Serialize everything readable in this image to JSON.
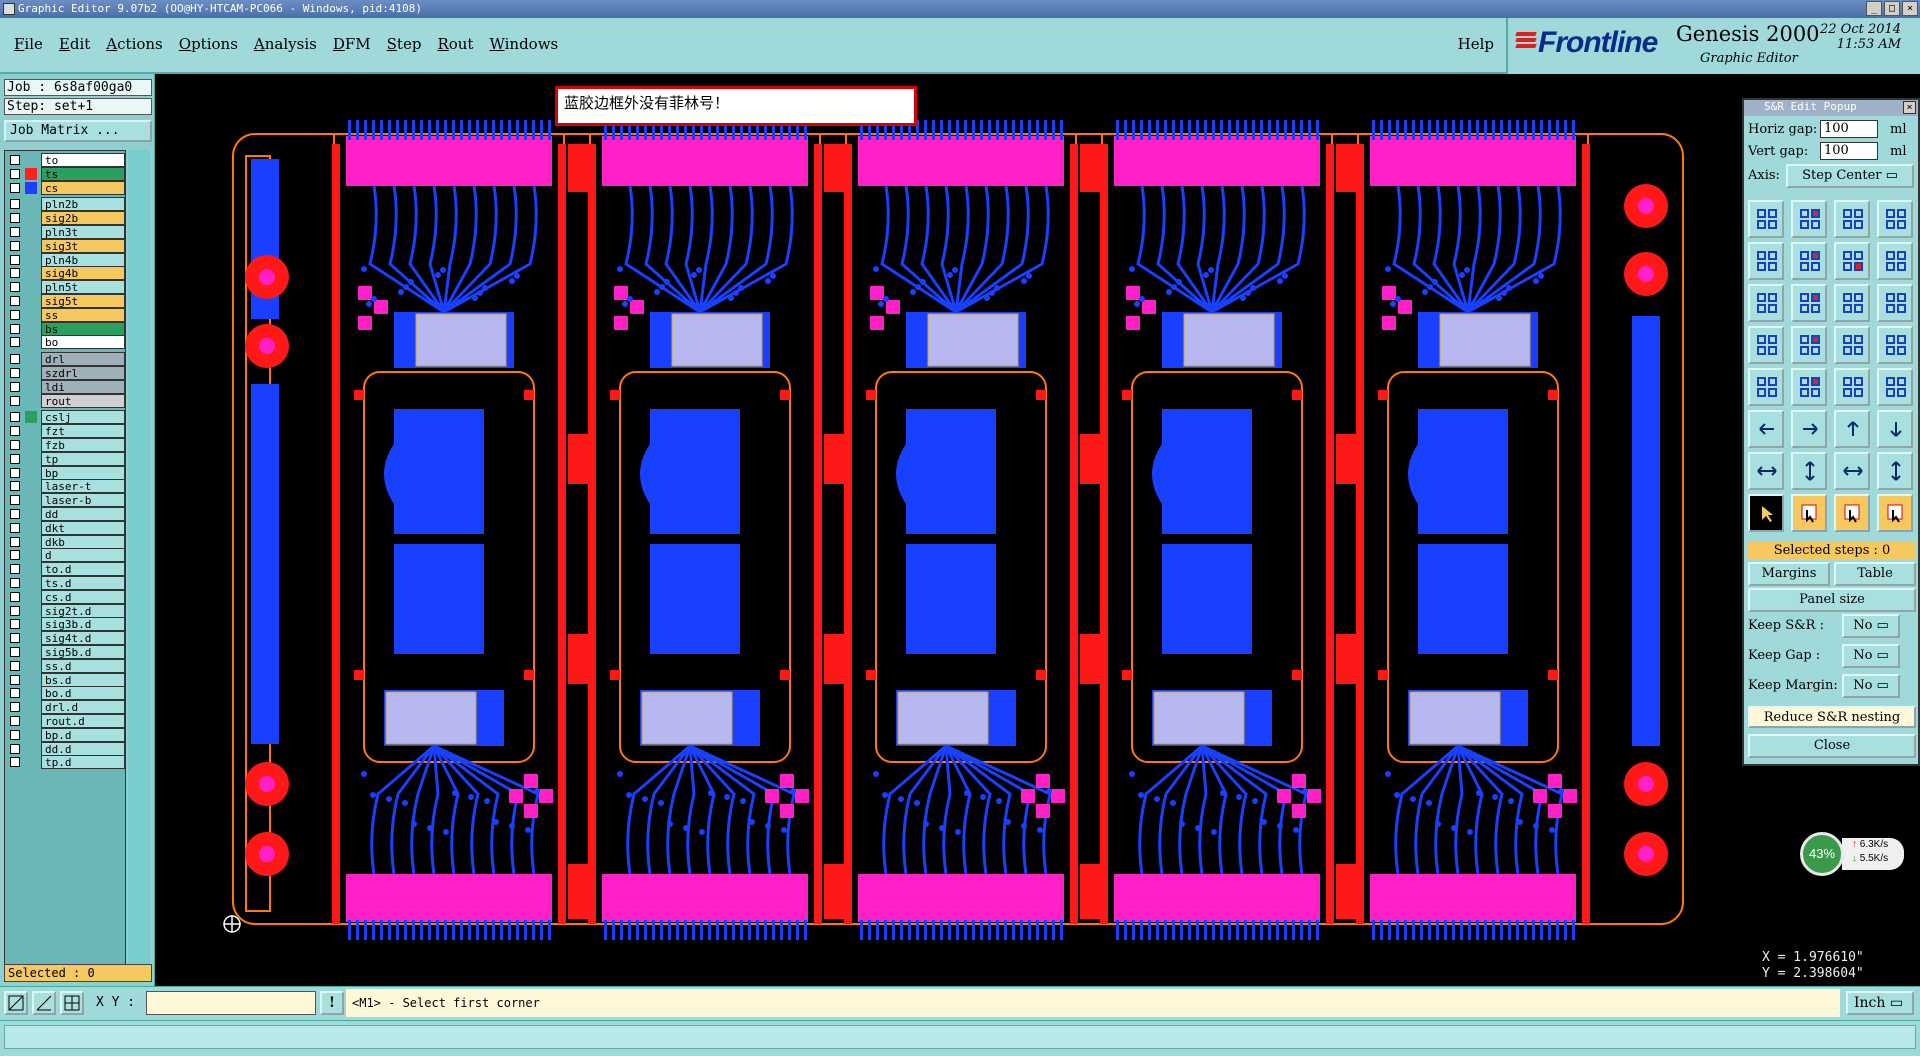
{
  "window": {
    "title": "Graphic Editor 9.07b2 (OO@HY-HTCAM-PC066 - Windows, pid:4108)",
    "buttons": [
      "_",
      "□",
      "×"
    ]
  },
  "menu": {
    "items": [
      "File",
      "Edit",
      "Actions",
      "Options",
      "Analysis",
      "DFM",
      "Step",
      "Rout",
      "Windows"
    ],
    "help": "Help"
  },
  "brand": {
    "logo": "Frontline",
    "product": "Genesis 2000",
    "subtitle": "Graphic Editor",
    "date": "22 Oct 2014",
    "time": "11:53 AM"
  },
  "job": {
    "job_label": "Job : 6s8af00ga0",
    "step_label": "Step: set+1",
    "job_matrix_button": "Job Matrix ..."
  },
  "layers": [
    {
      "name": "to",
      "swatch": "",
      "color": "#ffffff"
    },
    {
      "name": "ts",
      "swatch": "#ff2020",
      "color": "#2aa060"
    },
    {
      "name": "cs",
      "swatch": "#2040ff",
      "color": "#f5c860"
    },
    {
      "name": "pln2b",
      "swatch": "",
      "color": "#a8e0e0"
    },
    {
      "name": "sig2b",
      "swatch": "",
      "color": "#f5c860"
    },
    {
      "name": "pln3t",
      "swatch": "",
      "color": "#a8e0e0"
    },
    {
      "name": "sig3t",
      "swatch": "",
      "color": "#f5c860"
    },
    {
      "name": "pln4b",
      "swatch": "",
      "color": "#a8e0e0"
    },
    {
      "name": "sig4b",
      "swatch": "",
      "color": "#f5c860"
    },
    {
      "name": "pln5t",
      "swatch": "",
      "color": "#a8e0e0"
    },
    {
      "name": "sig5t",
      "swatch": "",
      "color": "#f5c860"
    },
    {
      "name": "ss",
      "swatch": "",
      "color": "#f5c860"
    },
    {
      "name": "bs",
      "swatch": "",
      "color": "#2aa060"
    },
    {
      "name": "bo",
      "swatch": "",
      "color": "#ffffff"
    },
    {
      "name": "drl",
      "swatch": "",
      "color": "#a0b0b8"
    },
    {
      "name": "szdrl",
      "swatch": "",
      "color": "#a0b0b8"
    },
    {
      "name": "ldi",
      "swatch": "",
      "color": "#a0b0b8"
    },
    {
      "name": "rout",
      "swatch": "",
      "color": "#d0d0d0"
    },
    {
      "name": "cslj",
      "swatch": "#2aa060",
      "color": "#a8e0e0"
    },
    {
      "name": "fzt",
      "swatch": "",
      "color": "#a8e0e0"
    },
    {
      "name": "fzb",
      "swatch": "",
      "color": "#a8e0e0"
    },
    {
      "name": "tp",
      "swatch": "",
      "color": "#a8e0e0"
    },
    {
      "name": "bp",
      "swatch": "",
      "color": "#a8e0e0"
    },
    {
      "name": "laser-t",
      "swatch": "",
      "color": "#a8e0e0"
    },
    {
      "name": "laser-b",
      "swatch": "",
      "color": "#a8e0e0"
    },
    {
      "name": "dd",
      "swatch": "",
      "color": "#a8e0e0"
    },
    {
      "name": "dkt",
      "swatch": "",
      "color": "#a8e0e0"
    },
    {
      "name": "dkb",
      "swatch": "",
      "color": "#a8e0e0"
    },
    {
      "name": "d",
      "swatch": "",
      "color": "#a8e0e0"
    },
    {
      "name": "to.d",
      "swatch": "",
      "color": "#a8e0e0"
    },
    {
      "name": "ts.d",
      "swatch": "",
      "color": "#a8e0e0"
    },
    {
      "name": "cs.d",
      "swatch": "",
      "color": "#a8e0e0"
    },
    {
      "name": "sig2t.d",
      "swatch": "",
      "color": "#a8e0e0"
    },
    {
      "name": "sig3b.d",
      "swatch": "",
      "color": "#a8e0e0"
    },
    {
      "name": "sig4t.d",
      "swatch": "",
      "color": "#a8e0e0"
    },
    {
      "name": "sig5b.d",
      "swatch": "",
      "color": "#a8e0e0"
    },
    {
      "name": "ss.d",
      "swatch": "",
      "color": "#a8e0e0"
    },
    {
      "name": "bs.d",
      "swatch": "",
      "color": "#a8e0e0"
    },
    {
      "name": "bo.d",
      "swatch": "",
      "color": "#a8e0e0"
    },
    {
      "name": "drl.d",
      "swatch": "",
      "color": "#a8e0e0"
    },
    {
      "name": "rout.d",
      "swatch": "",
      "color": "#a8e0e0"
    },
    {
      "name": "bp.d",
      "swatch": "",
      "color": "#a8e0e0"
    },
    {
      "name": "dd.d",
      "swatch": "",
      "color": "#a8e0e0"
    },
    {
      "name": "tp.d",
      "swatch": "",
      "color": "#a8e0e0"
    }
  ],
  "selected_label": "Selected : 0",
  "warning": "蓝胶边框外没有菲林号！",
  "sr_popup": {
    "title": "S&R Edit Popup",
    "horiz_gap_label": "Horiz gap:",
    "horiz_gap_value": "100",
    "vert_gap_label": "Vert  gap:",
    "vert_gap_value": "100",
    "unit": "ml",
    "axis_label": "Axis:",
    "axis_value": "Step Center",
    "selected_steps": "Selected steps : 0",
    "margins_button": "Margins",
    "table_button": "Table",
    "panel_size_button": "Panel size",
    "keep_sr_label": "Keep S&R  :",
    "keep_sr_value": "No",
    "keep_gap_label": "Keep Gap   :",
    "keep_gap_value": "No",
    "keep_margin_label": "Keep Margin:",
    "keep_margin_value": "No",
    "reduce_button": "Reduce S&R nesting",
    "close_button": "Close"
  },
  "network": {
    "percent": "43%",
    "up": "6.3K/s",
    "down": "5.5K/s"
  },
  "coords": {
    "x": "X = 1.976610\"",
    "y": "Y = 2.398604\""
  },
  "bottom": {
    "xy_label": "X Y :",
    "xy_value": "",
    "status": "<M1> - Select first corner",
    "units": "Inch"
  },
  "colors": {
    "outline": "#ff7a00",
    "copper_pink": "#ff20c8",
    "blue": "#1a40ff",
    "red": "#ff1818",
    "gold": "#d4a020",
    "chip": "#b8b8f0"
  }
}
